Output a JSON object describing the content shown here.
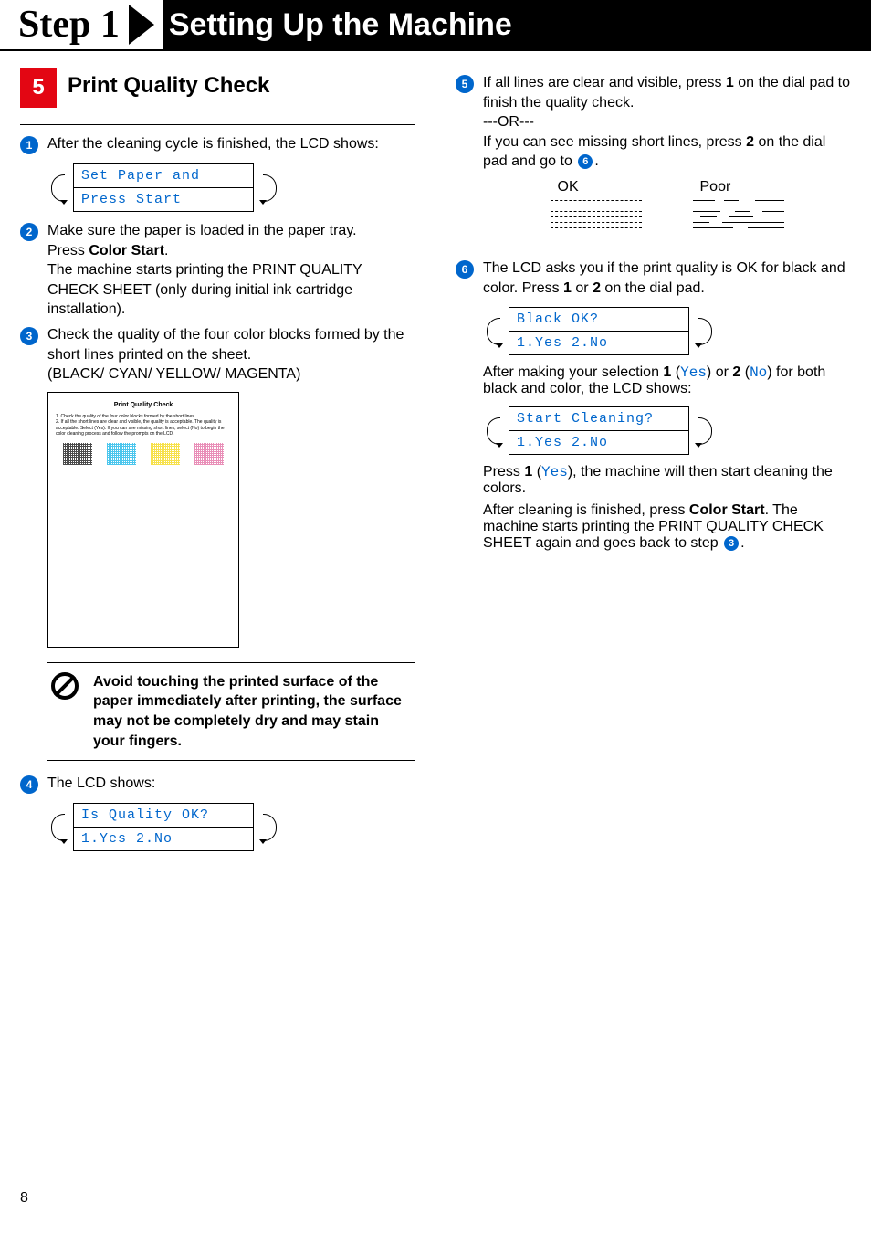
{
  "header": {
    "step_label": "Step 1",
    "title": "Setting Up the Machine"
  },
  "section": {
    "number": "5",
    "title": "Print Quality Check"
  },
  "left_column": {
    "s1": {
      "num": "1",
      "text": "After the cleaning cycle is finished, the LCD shows:"
    },
    "lcd1": {
      "line1": "Set Paper and",
      "line2": "Press Start"
    },
    "s2": {
      "num": "2",
      "text_a": "Make sure the paper is loaded in the paper tray.",
      "text_b": "Press ",
      "bold_b": "Color Start",
      "text_c": ".",
      "text_d": "The machine starts printing the PRINT QUALITY CHECK SHEET (only during initial ink cartridge installation)."
    },
    "s3": {
      "num": "3",
      "text_a": "Check the quality of the four color blocks formed by the short lines printed on the sheet.",
      "text_b": "(BLACK/ CYAN/ YELLOW/ MAGENTA)"
    },
    "sheet": {
      "title": "Print Quality Check",
      "line_a": "1. Check the quality of the four color blocks formed by the short lines.",
      "line_b": "2. If all the short lines are clear and visible, the quality is acceptable. The quality is acceptable. Select (Yes). If you can see missing short lines, select (No) to begin the color cleaning process and follow the prompts on the LCD."
    },
    "caution": "Avoid touching the printed surface of the paper immediately after printing, the surface may not be completely dry and may stain your fingers.",
    "s4": {
      "num": "4",
      "text": "The LCD shows:"
    },
    "lcd4": {
      "line1": "Is Quality OK?",
      "line2": "1.Yes 2.No"
    }
  },
  "right_column": {
    "s5": {
      "num": "5",
      "text_a": "If all lines are clear and visible, press ",
      "bold_a": "1",
      "text_b": " on the dial pad to finish the quality check.",
      "text_or": "---OR---",
      "text_c": "If you can see missing short lines, press ",
      "bold_c": "2",
      "text_d": " on the dial pad and go to ",
      "inline_ref": "6",
      "text_e": "."
    },
    "okpoor": {
      "ok_label": "OK",
      "poor_label": "Poor"
    },
    "s6": {
      "num": "6",
      "text_a": "The LCD asks you if the print quality is OK for black and color. Press ",
      "bold_a": "1",
      "text_b": " or ",
      "bold_b": "2",
      "text_c": " on the dial pad."
    },
    "lcd6a": {
      "line1": "Black OK?",
      "line2": "1.Yes 2.No"
    },
    "p_after_a": "After making your selection ",
    "bold_after_a1": "1",
    "mono_yes": "Yes",
    "p_after_b": " or ",
    "bold_after_b1": "2",
    "mono_no": "No",
    "p_after_c": " for both black and color, the LCD shows:",
    "lcd6b": {
      "line1": "Start Cleaning?",
      "line2": "1.Yes 2.No"
    },
    "p_clean_a": "Press ",
    "bold_clean_a": "1",
    "p_clean_b": ", the machine will then start cleaning the colors.",
    "p_clean_c": "After cleaning is finished, press ",
    "bold_clean_c": "Color Start",
    "p_clean_d": ". The machine starts printing the PRINT QUALITY CHECK SHEET again and goes back to step ",
    "inline_ref_3": "3",
    "p_clean_e": "."
  },
  "page_number": "8"
}
